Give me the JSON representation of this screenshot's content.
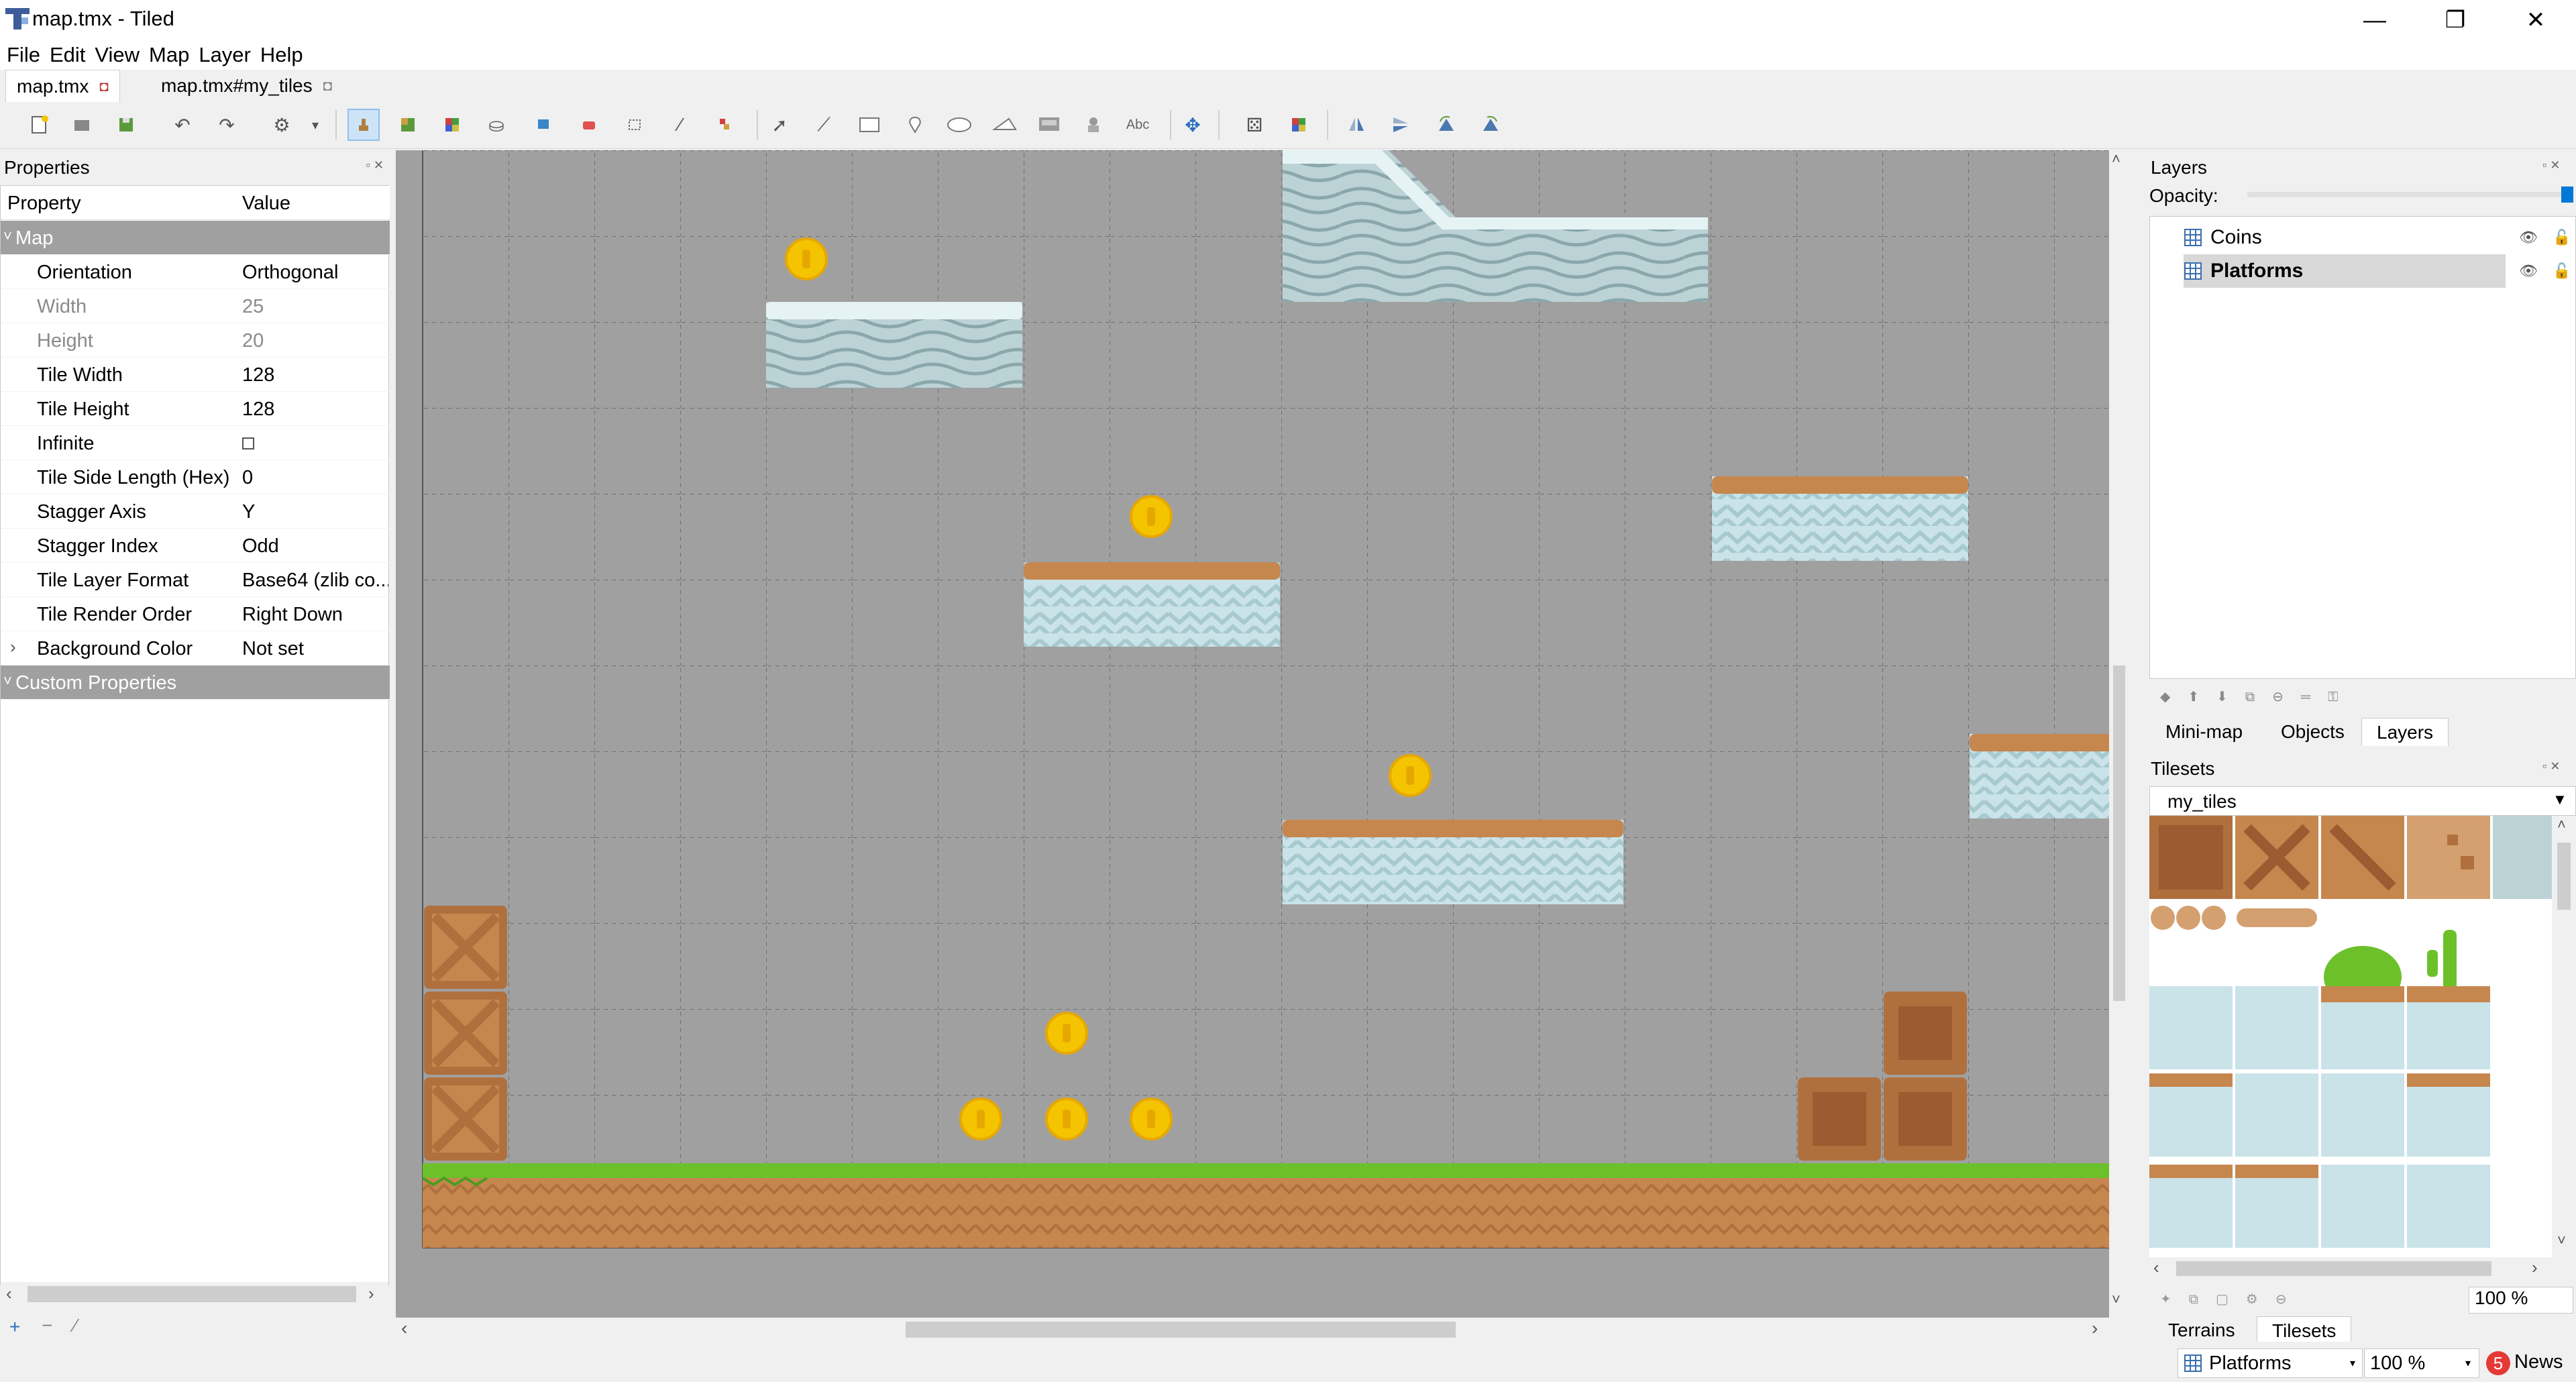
{
  "window": {
    "title": "map.tmx - Tiled",
    "minimize_glyph": "—",
    "maximize_glyph": "❐",
    "close_glyph": "✕",
    "icon": "tiled-app-icon"
  },
  "menu": [
    "File",
    "Edit",
    "View",
    "Map",
    "Layer",
    "Help"
  ],
  "doc_tabs": [
    {
      "label": "map.tmx",
      "active": true
    },
    {
      "label": "map.tmx#my_tiles",
      "active": false
    }
  ],
  "toolbar": {
    "icons": [
      "new-map-icon",
      "open-icon",
      "save-icon",
      "undo-icon",
      "redo-icon",
      "command-icon",
      "stamp-brush-icon",
      "terrain-brush-icon",
      "wang-brush-icon",
      "bucket-fill-icon",
      "shape-fill-icon",
      "eraser-icon",
      "rect-select-icon",
      "magic-wand-icon",
      "select-same-tile-icon",
      "select-objects-icon",
      "edit-polygons-icon",
      "insert-rectangle-icon",
      "insert-point-icon",
      "insert-ellipse-icon",
      "insert-polygon-icon",
      "insert-tile-icon",
      "insert-template-icon",
      "insert-text-icon",
      "layer-offset-icon",
      "random-mode-icon",
      "wang-fill-icon",
      "flip-horizontal-icon",
      "flip-vertical-icon",
      "rotate-left-icon",
      "rotate-right-icon"
    ],
    "text_icon_label": "Abc"
  },
  "properties": {
    "title": "Properties",
    "header": {
      "property": "Property",
      "value": "Value"
    },
    "map_group": "Map",
    "rows": [
      {
        "key": "Orientation",
        "value": "Orthogonal"
      },
      {
        "key": "Width",
        "value": "25"
      },
      {
        "key": "Height",
        "value": "20"
      },
      {
        "key": "Tile Width",
        "value": "128"
      },
      {
        "key": "Tile Height",
        "value": "128"
      },
      {
        "key": "Infinite",
        "value": ""
      },
      {
        "key": "Tile Side Length (Hex)",
        "value": "0"
      },
      {
        "key": "Stagger Axis",
        "value": "Y"
      },
      {
        "key": "Stagger Index",
        "value": "Odd"
      },
      {
        "key": "Tile Layer Format",
        "value": "Base64 (zlib co..."
      },
      {
        "key": "Tile Render Order",
        "value": "Right Down"
      },
      {
        "key": "Background Color",
        "value": "Not set"
      }
    ],
    "custom_group": "Custom Properties",
    "bottom_tools": [
      "+",
      "−",
      "⁄"
    ]
  },
  "layers": {
    "title": "Layers",
    "opacity_label": "Opacity:",
    "opacity": 1.0,
    "items": [
      {
        "name": "Coins",
        "selected": false
      },
      {
        "name": "Platforms",
        "selected": true
      }
    ],
    "tabs": [
      "Mini-map",
      "Objects",
      "Layers"
    ],
    "active_tab": "Layers"
  },
  "tilesets": {
    "title": "Tilesets",
    "current": "my_tiles",
    "zoom": "100 %",
    "tabs": [
      "Terrains",
      "Tilesets"
    ],
    "active_tab": "Tilesets"
  },
  "status": {
    "layer": "Platforms",
    "zoom": "100 %",
    "news_count": "5",
    "news_label": "News"
  },
  "colors": {
    "accent": "#0078d7",
    "map_bg": "#a0a0a0",
    "grass": "#6cc12b",
    "dirt": "#c6874f",
    "ice": "#c9e3e8",
    "coin": "#f5c400",
    "crate": "#b0703e"
  }
}
